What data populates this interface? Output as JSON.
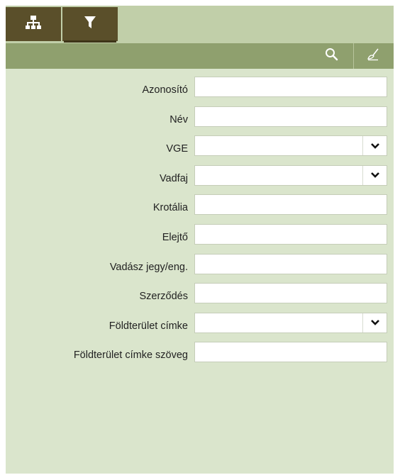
{
  "tabs": [
    {
      "icon": "sitemap-icon",
      "active": false
    },
    {
      "icon": "filter-icon",
      "active": true
    }
  ],
  "toolbar": {
    "search_icon": "search-icon",
    "clear_icon": "broom-icon"
  },
  "form": {
    "fields": [
      {
        "label": "Azonosító",
        "type": "text",
        "value": ""
      },
      {
        "label": "Név",
        "type": "text",
        "value": ""
      },
      {
        "label": "VGE",
        "type": "select",
        "value": ""
      },
      {
        "label": "Vadfaj",
        "type": "select",
        "value": ""
      },
      {
        "label": "Krotália",
        "type": "text",
        "value": ""
      },
      {
        "label": "Elejtő",
        "type": "text",
        "value": ""
      },
      {
        "label": "Vadász jegy/eng.",
        "type": "text",
        "value": ""
      },
      {
        "label": "Szerződés",
        "type": "text",
        "value": ""
      },
      {
        "label": "Földterület címke",
        "type": "select",
        "value": ""
      },
      {
        "label": "Földterület címke szöveg",
        "type": "text",
        "value": ""
      }
    ]
  },
  "colors": {
    "panel_bg": "#dae5cc",
    "tabbar_bg": "#c1cfa9",
    "tab_bg": "#5a4f2a",
    "toolbar_bg": "#8fa06e"
  }
}
